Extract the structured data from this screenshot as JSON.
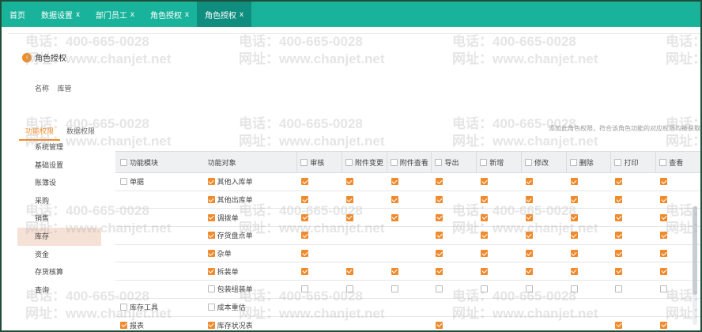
{
  "tabs": [
    {
      "label": "首页",
      "closable": false,
      "active": false
    },
    {
      "label": "数据设置",
      "closable": true,
      "active": false
    },
    {
      "label": "部门员工",
      "closable": true,
      "active": false
    },
    {
      "label": "角色授权",
      "closable": true,
      "active": false
    },
    {
      "label": "角色授权",
      "closable": true,
      "active": true
    }
  ],
  "close_glyph": "x",
  "title": {
    "icon": "role-icon",
    "icon_glyph": "♀",
    "text": "角色授权"
  },
  "role_name": {
    "label": "名称",
    "value": "库管"
  },
  "subtabs": [
    {
      "label": "功能权限",
      "active": true
    },
    {
      "label": "数据权限",
      "active": false
    }
  ],
  "hint": "添加此角色权限，符合该角色功能的对应权限均被获取",
  "categories": [
    {
      "label": "系统管理",
      "selected": false
    },
    {
      "label": "基础设置",
      "selected": false
    },
    {
      "label": "账簿设",
      "selected": false
    },
    {
      "label": "采购",
      "selected": false
    },
    {
      "label": "销售",
      "selected": false
    },
    {
      "label": "库存",
      "selected": true
    },
    {
      "label": "资金",
      "selected": false
    },
    {
      "label": "存货核算",
      "selected": false
    },
    {
      "label": "查询",
      "selected": false
    }
  ],
  "table": {
    "col_module": "功能模块",
    "col_object": "功能对象",
    "perm_cols": [
      "审核",
      "附件变更",
      "附件查看",
      "导出",
      "新增",
      "修改",
      "删除",
      "打印",
      "查看"
    ],
    "rows": [
      {
        "module": "单据",
        "module_checked": false,
        "object": "其他入库单",
        "object_checked": true,
        "perms": [
          true,
          true,
          true,
          true,
          true,
          true,
          true,
          true,
          true
        ]
      },
      {
        "module": "",
        "module_checked": null,
        "object": "其他出库单",
        "object_checked": true,
        "perms": [
          true,
          true,
          true,
          true,
          true,
          true,
          true,
          true,
          true
        ]
      },
      {
        "module": "",
        "module_checked": null,
        "object": "调拨单",
        "object_checked": true,
        "perms": [
          true,
          true,
          true,
          true,
          true,
          true,
          true,
          true,
          true
        ]
      },
      {
        "module": "",
        "module_checked": null,
        "object": "存货盘点单",
        "object_checked": true,
        "perms": [
          true,
          null,
          null,
          true,
          true,
          true,
          true,
          true,
          true
        ]
      },
      {
        "module": "",
        "module_checked": null,
        "object": "杂单",
        "object_checked": true,
        "perms": [
          true,
          null,
          null,
          true,
          true,
          true,
          true,
          true,
          true
        ]
      },
      {
        "module": "",
        "module_checked": null,
        "object": "拆装单",
        "object_checked": true,
        "perms": [
          true,
          true,
          true,
          true,
          true,
          true,
          true,
          true,
          true
        ]
      },
      {
        "module": "",
        "module_checked": null,
        "object": "包装组装单",
        "object_checked": false,
        "perms": [
          false,
          false,
          false,
          false,
          false,
          false,
          false,
          false,
          false
        ]
      },
      {
        "module": "库存工具",
        "module_checked": false,
        "object": "成本重估",
        "object_checked": false,
        "perms": [
          null,
          null,
          null,
          null,
          null,
          null,
          null,
          null,
          null
        ]
      },
      {
        "module": "报表",
        "module_checked": true,
        "object": "库存状况表",
        "object_checked": true,
        "perms": [
          null,
          null,
          null,
          true,
          null,
          null,
          null,
          true,
          true
        ]
      }
    ]
  },
  "watermark": {
    "phone": "电话：400-665-0028",
    "site": "网址：www.chanjet.net"
  },
  "colors": {
    "topbar": "#19b39c",
    "active_tab": "#0f8e7f",
    "accent": "#f28c28",
    "selected_row": "#f6e1d6"
  }
}
